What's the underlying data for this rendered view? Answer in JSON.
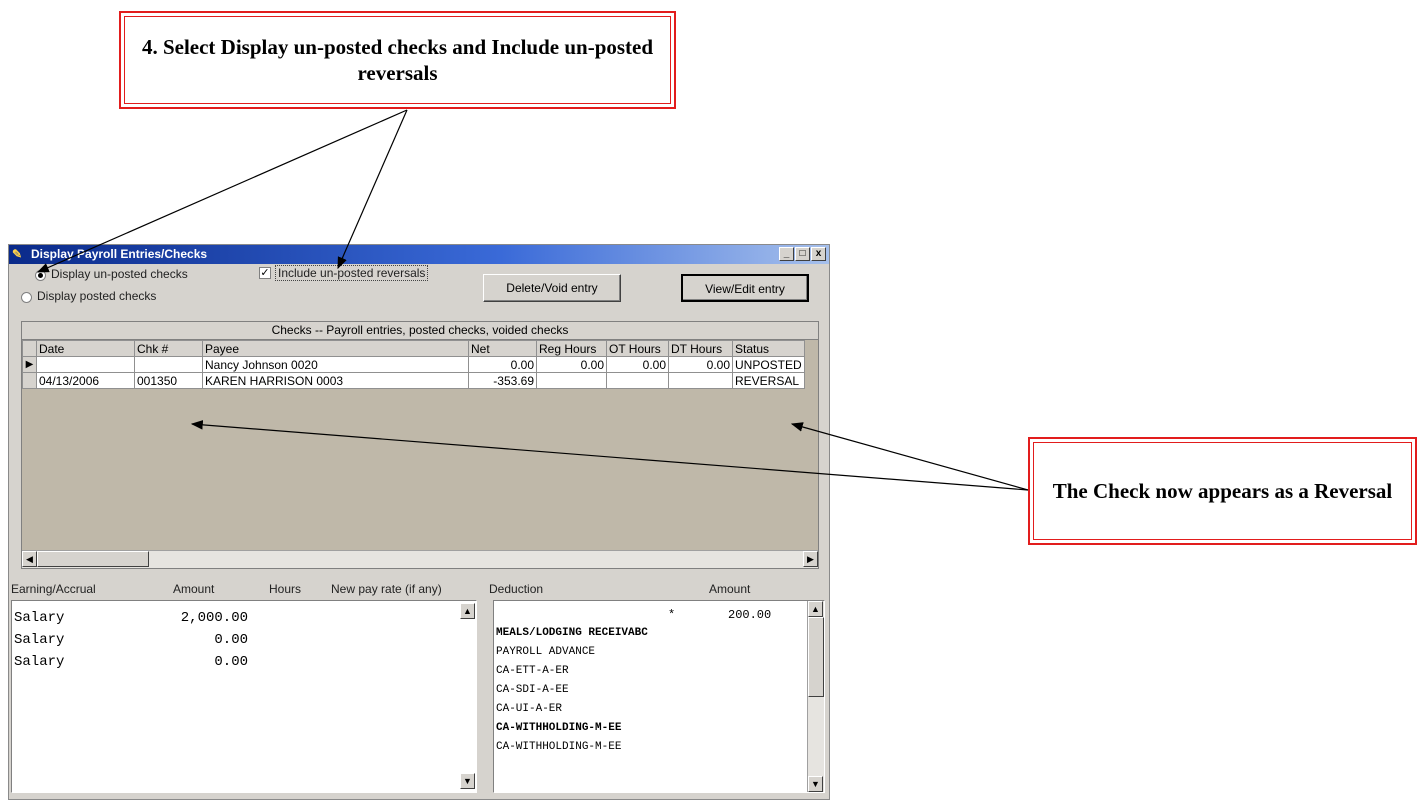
{
  "callouts": {
    "step4": "4. Select Display un-posted checks and Include un-posted reversals",
    "reversal": "The Check now appears as a Reversal"
  },
  "window": {
    "title": "Display Payroll Entries/Checks",
    "controls": {
      "minimize": "_",
      "maximize": "□",
      "close": "x"
    }
  },
  "options": {
    "unposted": "Display un-posted checks",
    "unposted_selected": true,
    "posted": "Display posted checks",
    "posted_selected": false,
    "include_reversals": "Include un-posted reversals",
    "include_reversals_checked": true
  },
  "buttons": {
    "delete_void": "Delete/Void entry",
    "view_edit": "View/Edit entry"
  },
  "checks_grid": {
    "caption": "Checks -- Payroll entries, posted checks, voided checks",
    "columns": [
      "Date",
      "Chk #",
      "Payee",
      "Net",
      "Reg Hours",
      "OT Hours",
      "DT Hours",
      "Status"
    ],
    "rows": [
      {
        "current": true,
        "date": "",
        "chk": "",
        "payee": "Nancy Johnson 0020",
        "net": "0.00",
        "reg": "0.00",
        "ot": "0.00",
        "dt": "0.00",
        "status": "UNPOSTED"
      },
      {
        "current": false,
        "date": "04/13/2006",
        "chk": "001350",
        "payee": "KAREN HARRISON 0003",
        "net": "-353.69",
        "reg": "",
        "ot": "",
        "dt": "",
        "status": "REVERSAL"
      }
    ]
  },
  "earnings": {
    "headers": {
      "earning": "Earning/Accrual",
      "amount": "Amount",
      "hours": "Hours",
      "rate": "New pay rate (if any)"
    },
    "rows": [
      {
        "name": "Salary",
        "amount": "2,000.00"
      },
      {
        "name": "Salary",
        "amount": "0.00"
      },
      {
        "name": "Salary",
        "amount": "0.00"
      }
    ]
  },
  "deductions": {
    "headers": {
      "deduction": "Deduction",
      "amount": "Amount"
    },
    "first_row": {
      "marker": "*",
      "amount": "200.00"
    },
    "items": [
      "MEALS/LODGING RECEIVABC",
      "PAYROLL ADVANCE",
      "CA-ETT-A-ER",
      "CA-SDI-A-EE",
      "CA-UI-A-ER",
      "CA-WITHHOLDING-M-EE",
      "CA-WITHHOLDING-M-EE"
    ]
  }
}
